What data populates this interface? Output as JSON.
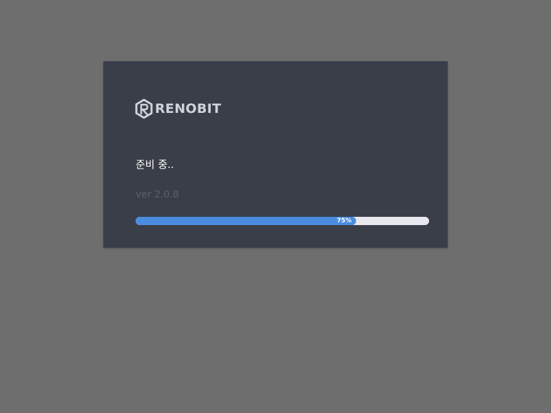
{
  "brand": {
    "name": "RENOBIT",
    "icon": "renobit-logo-icon",
    "text_color": "#cfd3da"
  },
  "status": {
    "message": "준비 중.."
  },
  "version": {
    "label": "ver 2.0.8"
  },
  "progress": {
    "percent": 75,
    "label": "75%",
    "fill_color": "#4a8ce0",
    "track_color": "#e8e9ee"
  },
  "colors": {
    "background": "#6e6e6e",
    "panel": "#3a3e49"
  }
}
